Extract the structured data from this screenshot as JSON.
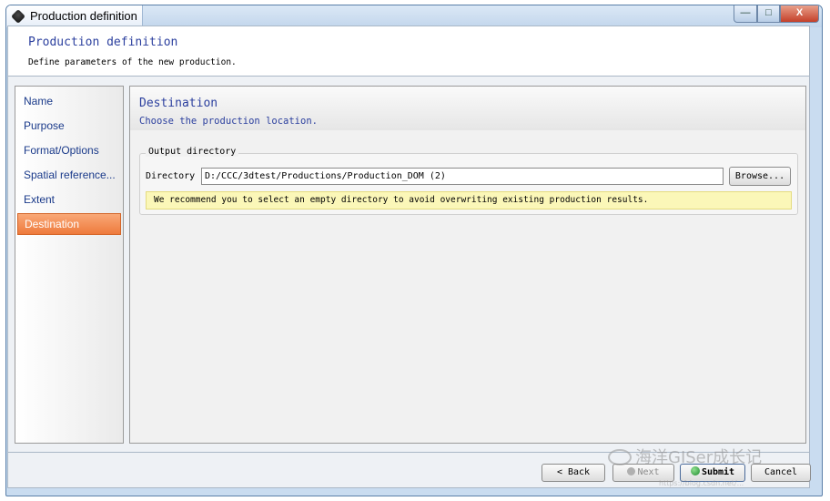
{
  "window": {
    "title": "Production definition",
    "min_glyph": "—",
    "max_glyph": "□",
    "close_glyph": "X"
  },
  "header": {
    "title": "Production definition",
    "subtitle": "Define parameters of the new production."
  },
  "sidebar": {
    "items": [
      {
        "label": "Name"
      },
      {
        "label": "Purpose"
      },
      {
        "label": "Format/Options"
      },
      {
        "label": "Spatial reference..."
      },
      {
        "label": "Extent"
      },
      {
        "label": "Destination",
        "active": true
      }
    ]
  },
  "page": {
    "title": "Destination",
    "subtitle": "Choose the production location.",
    "group_label": "Output directory",
    "directory_label": "Directory",
    "directory_value": "D:/CCC/3dtest/Productions/Production_DOM (2)",
    "browse_label": "Browse...",
    "warning": "We recommend you to select an empty directory to avoid overwriting existing production results."
  },
  "footer": {
    "back_label": "< Back",
    "next_label": "Next",
    "submit_label": "Submit",
    "cancel_label": "Cancel"
  },
  "watermark": {
    "text": "海洋GISer成长记",
    "url": "https://blog.csdn.net/..."
  },
  "colors": {
    "accent_orange": "#ee7a3c",
    "link_blue": "#2b3f9e",
    "warning_bg": "#fbf7b8"
  }
}
